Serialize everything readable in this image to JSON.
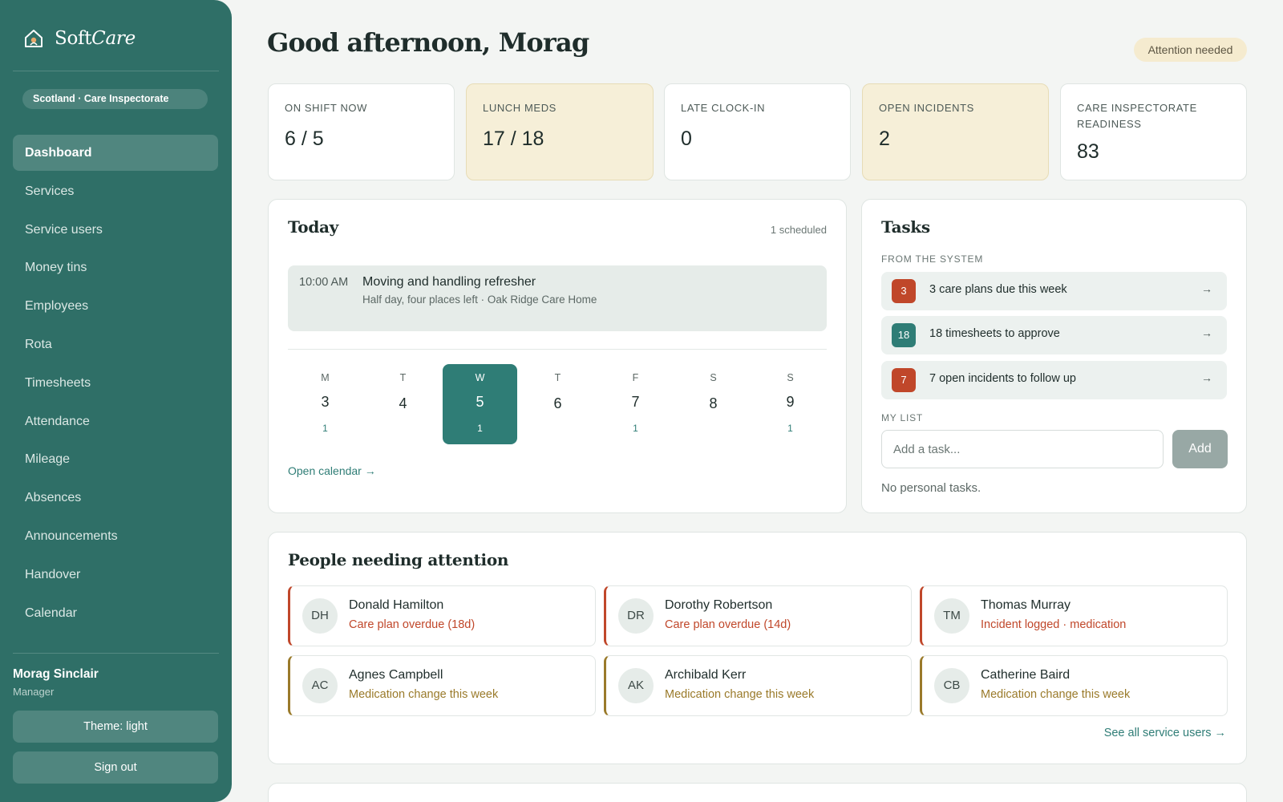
{
  "brand": {
    "name_main": "Soft",
    "name_accent": "Care",
    "region": "Scotland · Care Inspectorate"
  },
  "nav": [
    {
      "label": "Dashboard",
      "active": true
    },
    {
      "label": "Services"
    },
    {
      "label": "Service users"
    },
    {
      "label": "Money tins"
    },
    {
      "label": "Employees"
    },
    {
      "label": "Rota"
    },
    {
      "label": "Timesheets"
    },
    {
      "label": "Attendance"
    },
    {
      "label": "Mileage"
    },
    {
      "label": "Absences"
    },
    {
      "label": "Announcements"
    },
    {
      "label": "Handover"
    },
    {
      "label": "Calendar"
    }
  ],
  "user": {
    "name": "Morag Sinclair",
    "role": "Manager",
    "theme_label": "Theme: light",
    "signout_label": "Sign out"
  },
  "header": {
    "greeting": "Good afternoon, Morag",
    "badge": "Attention needed"
  },
  "stats": [
    {
      "label": "On shift now",
      "value": "6 / 5"
    },
    {
      "label": "Lunch meds",
      "value": "17 / 18",
      "warn": true
    },
    {
      "label": "Late clock-in",
      "value": "0"
    },
    {
      "label": "Open incidents",
      "value": "2",
      "warn": true
    },
    {
      "label": "Care Inspectorate readiness",
      "value": "83"
    }
  ],
  "today": {
    "title": "Today",
    "scheduled": "1 scheduled",
    "event": {
      "time": "10:00 AM",
      "title": "Moving and handling refresher",
      "subtitle": "Half day, four places left · Oak Ridge Care Home"
    },
    "week": [
      {
        "letter": "M",
        "num": "3",
        "count": "1"
      },
      {
        "letter": "T",
        "num": "4",
        "count": ""
      },
      {
        "letter": "W",
        "num": "5",
        "count": "1",
        "today": true
      },
      {
        "letter": "T",
        "num": "6",
        "count": ""
      },
      {
        "letter": "F",
        "num": "7",
        "count": "1"
      },
      {
        "letter": "S",
        "num": "8",
        "count": ""
      },
      {
        "letter": "S",
        "num": "9",
        "count": "1"
      }
    ],
    "open_calendar": "Open calendar →"
  },
  "tasks": {
    "title": "Tasks",
    "system_label": "From the system",
    "system_items": [
      {
        "count": "3",
        "text": "3 care plans due this week",
        "color": "#c0472a"
      },
      {
        "count": "18",
        "text": "18 timesheets to approve",
        "color": "#2f7d76"
      },
      {
        "count": "7",
        "text": "7 open incidents to follow up",
        "color": "#c0472a"
      }
    ],
    "arrow": "→",
    "my_list_label": "My list",
    "input_placeholder": "Add a task...",
    "add_label": "Add",
    "empty": "No personal tasks."
  },
  "people": {
    "title": "People needing attention",
    "items": [
      {
        "initials": "DH",
        "name": "Donald Hamilton",
        "note": "Care plan overdue (18d)",
        "kind": "alert"
      },
      {
        "initials": "DR",
        "name": "Dorothy Robertson",
        "note": "Care plan overdue (14d)",
        "kind": "alert"
      },
      {
        "initials": "TM",
        "name": "Thomas Murray",
        "note": "Incident logged · medication",
        "kind": "alert"
      },
      {
        "initials": "AC",
        "name": "Agnes Campbell",
        "note": "Medication change this week",
        "kind": "med"
      },
      {
        "initials": "AK",
        "name": "Archibald Kerr",
        "note": "Medication change this week",
        "kind": "med"
      },
      {
        "initials": "CB",
        "name": "Catherine Baird",
        "note": "Medication change this week",
        "kind": "med"
      }
    ],
    "see_all": "See all service users →"
  },
  "colors": {
    "sidebar": "#2f6f67",
    "accent": "#2f7d76",
    "alert": "#c0472a",
    "warning_bg": "#f6efd8",
    "med": "#9a7a2a"
  }
}
